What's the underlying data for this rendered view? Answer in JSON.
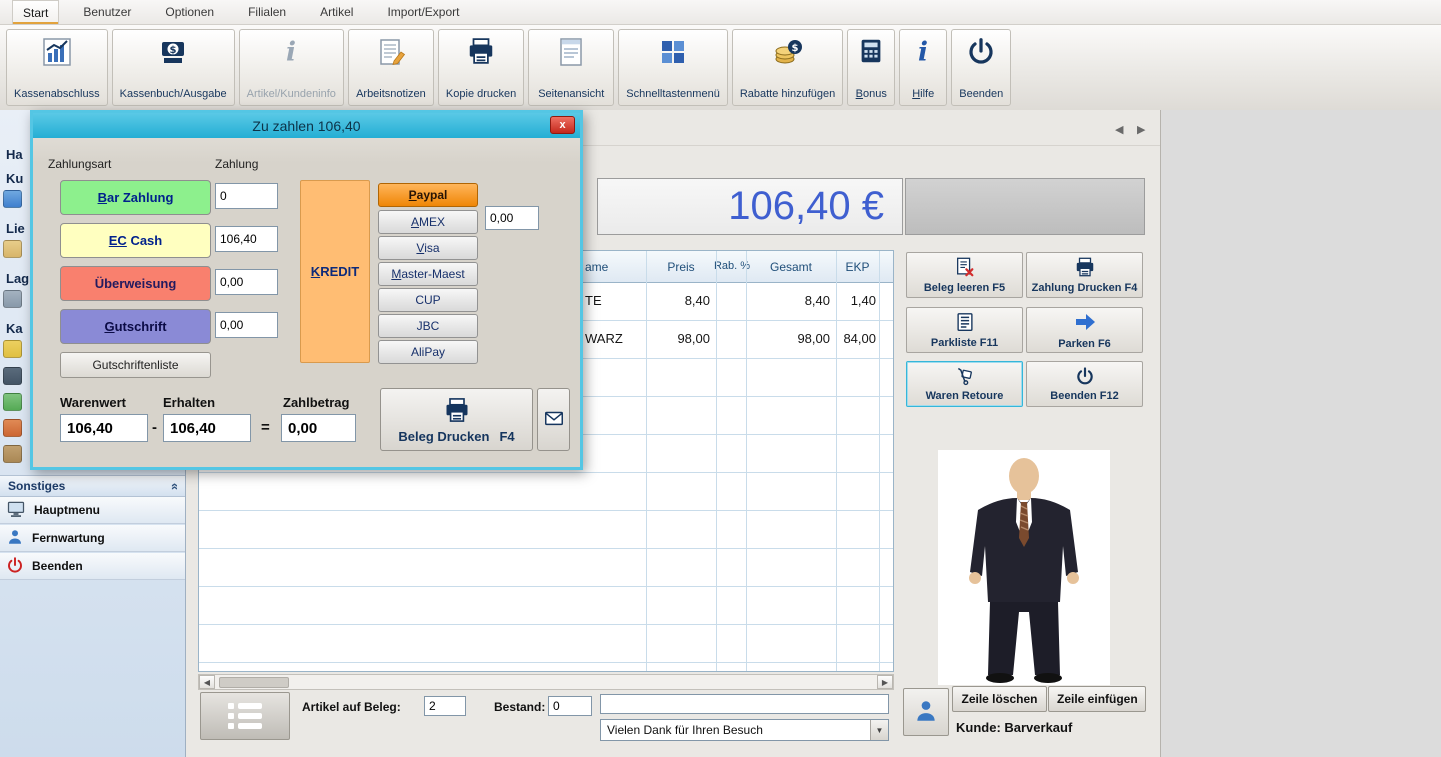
{
  "tabs": [
    "Start",
    "Benutzer",
    "Optionen",
    "Filialen",
    "Artikel",
    "Import/Export"
  ],
  "ribbon": {
    "buttons": [
      {
        "u": "",
        "rest": "Kassenabschluss"
      },
      {
        "u": "",
        "rest": "Kassenbuch/Ausgabe"
      },
      {
        "u": "",
        "rest": "Artikel/Kundeninfo"
      },
      {
        "u": "",
        "rest": "Arbeitsnotizen"
      },
      {
        "u": "",
        "rest": "Kopie drucken"
      },
      {
        "u": "",
        "rest": "Seitenansicht"
      },
      {
        "u": "",
        "rest": "Schnelltastenmenü"
      },
      {
        "u": "",
        "rest": "Rabatte hinzufügen"
      },
      {
        "u": "B",
        "rest": "onus"
      },
      {
        "u": "H",
        "rest": "ilfe"
      },
      {
        "u": "",
        "rest": "Beenden"
      }
    ]
  },
  "dialog": {
    "title": "Zu zahlen 106,40",
    "close": "x",
    "zahlungsart_label": "Zahlungsart",
    "zahlung_label": "Zahlung",
    "payment_types": [
      {
        "u": "B",
        "rest": "ar Zahlung",
        "value": "0"
      },
      {
        "u": "EC",
        "rest": " Cash",
        "value": "106,40"
      },
      {
        "u": "",
        "rest": "Überweisung",
        "value": "0,00"
      },
      {
        "u": "G",
        "rest": "utschrift",
        "value": "0,00"
      }
    ],
    "gutschriftenliste_label": "Gutschriftenliste",
    "kredit": {
      "u": "K",
      "rest": "REDIT"
    },
    "credit_amount": "0,00",
    "credit_buttons": [
      {
        "u": "P",
        "rest": "aypal"
      },
      {
        "u": "A",
        "rest": "MEX"
      },
      {
        "u": "V",
        "rest": "isa"
      },
      {
        "u": "M",
        "rest": "aster-Maest"
      },
      {
        "u": "",
        "rest": "CUP"
      },
      {
        "u": "",
        "rest": "JBC"
      },
      {
        "u": "",
        "rest": "AliPay"
      }
    ],
    "summary": {
      "warenwert_label": "Warenwert",
      "erhalten_label": "Erhalten",
      "zahlbetrag_label": "Zahlbetrag",
      "warenwert": "106,40",
      "erhalten": "106,40",
      "zahlbetrag": "0,00",
      "minus": "-",
      "equals": "="
    },
    "print_label": "Beleg Drucken",
    "print_key": "F4"
  },
  "sidebar": {
    "fragments": [
      "Ha",
      "Ku",
      "Lie",
      "Lag",
      "Ka"
    ],
    "sonstiges_label": "Sonstiges",
    "items": [
      {
        "label": "Hauptmenu"
      },
      {
        "label": "Fernwartung"
      },
      {
        "label": "Beenden"
      }
    ]
  },
  "main": {
    "total": "106,40 €",
    "table": {
      "headers": [
        "ame",
        "Preis",
        "Rab. %",
        "Gesamt",
        "EKP"
      ],
      "rows": [
        {
          "name": "TE",
          "preis": "8,40",
          "rab": "",
          "gesamt": "8,40",
          "ekp": "1,40"
        },
        {
          "name": "WARZ",
          "preis": "98,00",
          "rab": "",
          "gesamt": "98,00",
          "ekp": "84,00"
        }
      ]
    },
    "actions": [
      {
        "label": "Beleg leeren F5"
      },
      {
        "label": "Zahlung Drucken F4"
      },
      {
        "label": "Parkliste F11"
      },
      {
        "label": "Parken F6"
      },
      {
        "label": "Waren Retoure"
      },
      {
        "label": "Beenden F12"
      }
    ],
    "zeile_loeschen": "Zeile löschen",
    "zeile_einfuegen": "Zeile einfügen",
    "kunde": "Kunde: Barverkauf"
  },
  "bottom": {
    "artikel_label": "Artikel auf Beleg:",
    "artikel_value": "2",
    "bestand_label": "Bestand:",
    "bestand_value": "0",
    "message_value": "",
    "dropdown_value": "Vielen Dank für Ihren Besuch"
  },
  "glyphs": {
    "prev": "◀",
    "next": "▶",
    "down": "▼",
    "chevron_up": "»"
  },
  "colors": {
    "dialog_accent": "#54c6e4",
    "bar_zahlung": "#8df08d",
    "ec_cash": "#ffffc0",
    "ueberweisung": "#f9806e",
    "gutschrift": "#8a8ad6",
    "kredit": "#ffbd73",
    "paypal_selected": "#ef8606",
    "total_text": "#3f5fd0",
    "navy_text": "#17365d"
  }
}
